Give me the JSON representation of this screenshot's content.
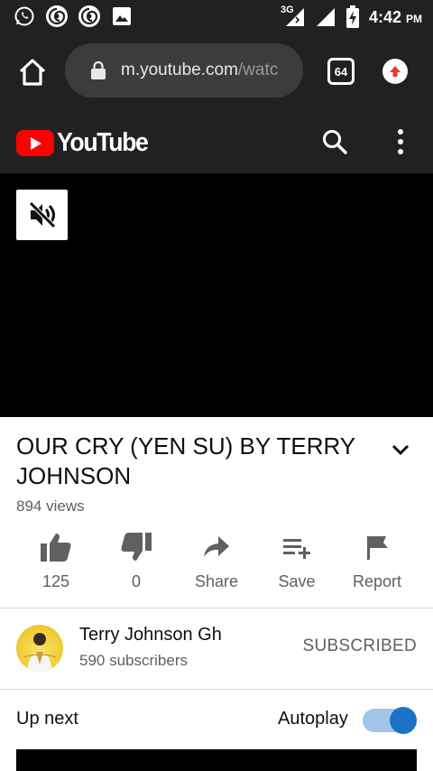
{
  "status_bar": {
    "time": "4:42",
    "ampm": "PM",
    "network": "3G",
    "icons": [
      "whatsapp-icon",
      "app-swirl-icon",
      "app-swirl-icon",
      "gallery-icon",
      "signal-3g-icon",
      "signal-icon",
      "battery-charging-icon"
    ]
  },
  "browser": {
    "url_host": "m.youtube.com",
    "url_rest": "/watc",
    "tab_count": "64"
  },
  "youtube": {
    "brand": "YouTube",
    "brand_color": "#ff0000"
  },
  "video": {
    "title": "OUR CRY (YEN SU) BY TERRY JOHNSON",
    "views": "894 views"
  },
  "actions": {
    "like_count": "125",
    "dislike_count": "0",
    "share_label": "Share",
    "save_label": "Save",
    "report_label": "Report"
  },
  "channel": {
    "name": "Terry Johnson Gh",
    "subscribers": "590 subscribers",
    "subscribe_state": "SUBSCRIBED"
  },
  "up_next": {
    "label": "Up next",
    "autoplay_label": "Autoplay",
    "autoplay_on": true,
    "toggle_color": "#1a73c9"
  }
}
